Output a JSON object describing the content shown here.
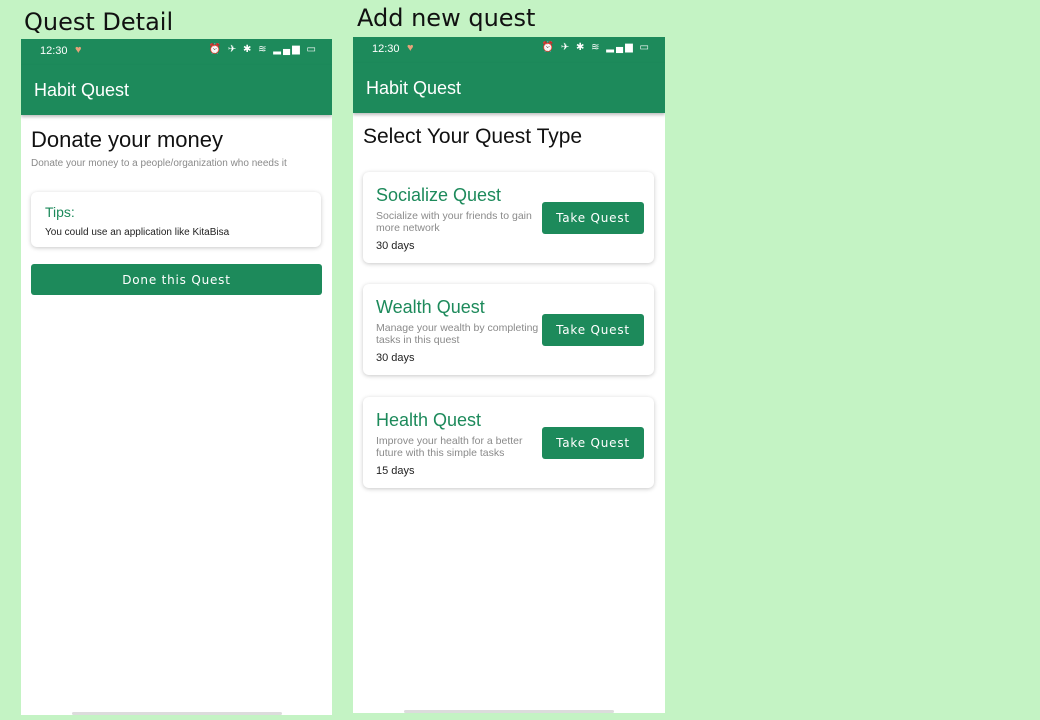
{
  "labels": {
    "left": "Quest Detail",
    "right": "Add new quest"
  },
  "statusbar": {
    "time": "12:30",
    "heart_icon": "heart-icon",
    "sys_icons": "⏰ ✈ ✱ ≋ ▂▄▆ ▭"
  },
  "app": {
    "title": "Habit Quest",
    "brand_color": "#1d8a5b"
  },
  "detail": {
    "title": "Donate your money",
    "subtitle": "Donate your money to a people/organization who needs it",
    "tips": {
      "title": "Tips:",
      "text": "You could use an application like KitaBisa"
    },
    "done_button": "Done this Quest"
  },
  "select": {
    "heading": "Select Your Quest Type",
    "quests": [
      {
        "title": "Socialize Quest",
        "description": "Socialize with your friends to gain more network",
        "days": "30 days",
        "button": "Take Quest"
      },
      {
        "title": "Wealth Quest",
        "description": "Manage your wealth by completing tasks in this quest",
        "days": "30 days",
        "button": "Take Quest"
      },
      {
        "title": "Health Quest",
        "description": "Improve your health for a better future with this simple tasks",
        "days": "15 days",
        "button": "Take Quest"
      }
    ]
  }
}
